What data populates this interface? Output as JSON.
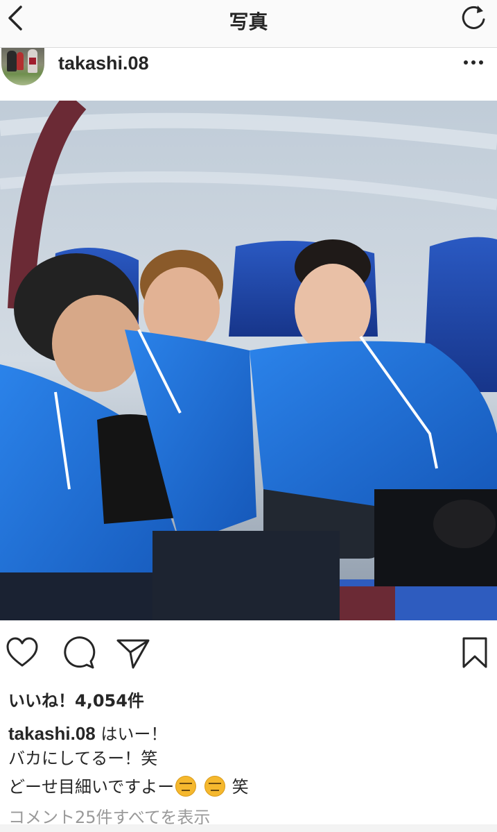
{
  "nav": {
    "title": "写真",
    "back_icon": "chevron-left-icon",
    "refresh_icon": "refresh-icon"
  },
  "post": {
    "username": "takashi.08",
    "more_icon": "more-horizontal-icon",
    "photo_alt": "Three players in blue jackets sitting on a team bench"
  },
  "actions": {
    "icons": [
      "heart-icon",
      "comment-icon",
      "share-icon",
      "bookmark-icon"
    ]
  },
  "likes_label": "いいね！4,054件",
  "caption": {
    "username": "takashi.08",
    "line1": " はいー！",
    "line2": "バカにしてるー！笑",
    "line3_prefix": "どーせ目細いですよー",
    "line3_suffix": "笑",
    "emoji": "expressionless-face-emoji"
  },
  "view_comments": "コメント25件すべてを表示",
  "colors": {
    "text": "#262626",
    "muted": "#999999",
    "jacket_blue": "#1f6fd6",
    "seat_blue": "#1e4fb5"
  }
}
